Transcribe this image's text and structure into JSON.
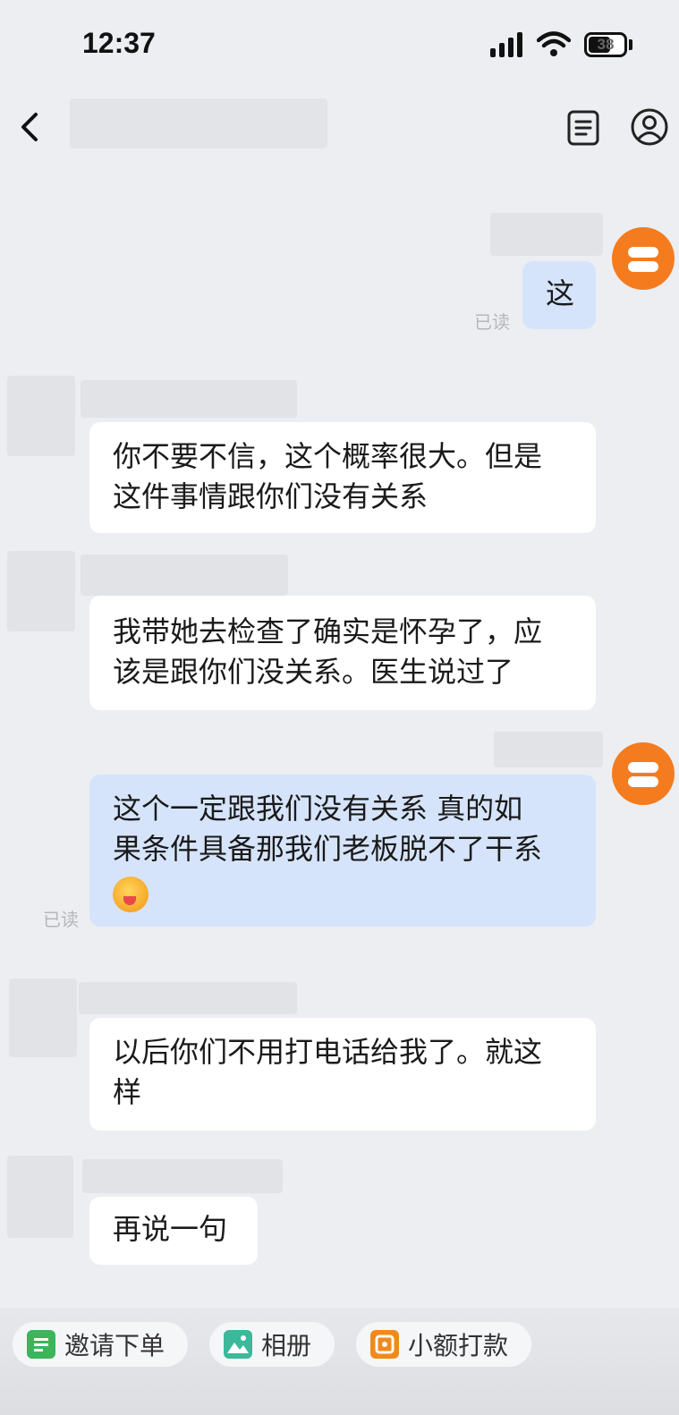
{
  "status_bar": {
    "time": "12:37",
    "battery_level": "38"
  },
  "nav": {
    "back_icon": "chevron-left-icon",
    "doc_icon": "document-icon",
    "user_icon": "user-icon"
  },
  "messages": [
    {
      "direction": "out",
      "lines": [
        "这"
      ],
      "read_label": "已读"
    },
    {
      "direction": "in",
      "lines": [
        "你不要不信，这个概率很大。但是",
        "这件事情跟你们没有关系"
      ]
    },
    {
      "direction": "in",
      "lines": [
        "我带她去检查了确实是怀孕了，应",
        "该是跟你们没关系。医生说过了"
      ]
    },
    {
      "direction": "out",
      "lines": [
        "这个一定跟我们没有关系 真的如",
        "果条件具备那我们老板脱不了干系"
      ],
      "has_emoji": true,
      "read_label": "已读"
    },
    {
      "direction": "in",
      "lines": [
        "以后你们不用打电话给我了。就这",
        "样"
      ]
    },
    {
      "direction": "in",
      "lines": [
        "再说一句"
      ]
    }
  ],
  "toolbar": {
    "items": [
      {
        "label": "邀请下单",
        "icon": "invite-order-icon",
        "color": "#3cb55a"
      },
      {
        "label": "相册",
        "icon": "photo-album-icon",
        "color": "#3cb89a"
      },
      {
        "label": "小额打款",
        "icon": "small-payment-icon",
        "color": "#f08a1c"
      }
    ]
  },
  "colors": {
    "avatar": "#f47c1f",
    "outgoing_bubble": "#d6e4fb",
    "incoming_bubble": "#ffffff",
    "background": "#eceef2"
  }
}
